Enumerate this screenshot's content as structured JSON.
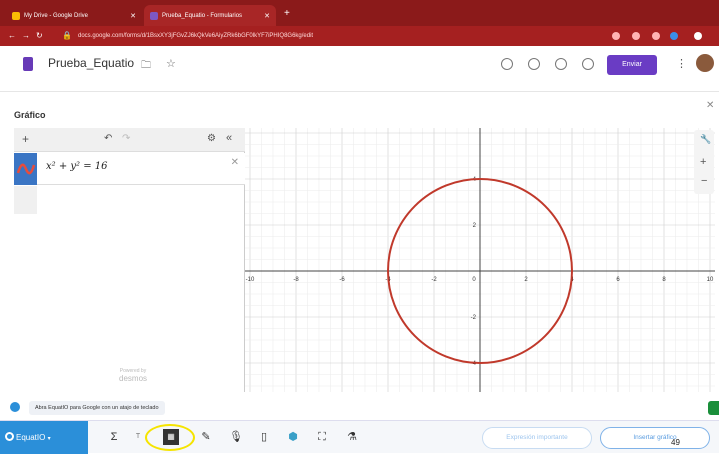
{
  "browser": {
    "tabs": [
      {
        "title": "My Drive - Google Drive",
        "active": false,
        "favicon_color": "#fbbc04"
      },
      {
        "title": "Prueba_Equatio - Formularios",
        "active": true,
        "favicon_color": "#7e57c2"
      }
    ],
    "url": "docs.google.com/forms/d/1BsxXY3jFGvZJ6kQkVe6AiyZRk6bGF0lkYF7iPHIQ8G6kg/edit"
  },
  "doc": {
    "title": "Prueba_Equatio",
    "send_label": "Enviar"
  },
  "panel": {
    "title": "Gráfico",
    "expression": "x² + y² = 16",
    "watermark_small": "Powered by",
    "watermark": "desmos"
  },
  "chart_data": {
    "type": "scatter",
    "title": "",
    "xlabel": "",
    "ylabel": "",
    "xlim": [
      -10,
      10
    ],
    "ylim": [
      -5.5,
      5.5
    ],
    "grid": true,
    "x_ticks": [
      -10,
      -8,
      -6,
      -4,
      -2,
      0,
      2,
      4,
      6,
      8,
      10
    ],
    "y_ticks": [
      -4,
      -2,
      2,
      4
    ],
    "x_tick_labels": [
      "-10",
      "-8",
      "-6",
      "-4",
      "-2",
      "0",
      "2",
      "4",
      "6",
      "8",
      "10"
    ],
    "y_tick_labels": [
      "-4",
      "-2",
      "2",
      "4"
    ],
    "curves": [
      {
        "equation": "x^2 + y^2 = 16",
        "center": [
          0,
          0
        ],
        "radius": 4,
        "color": "#c0392b"
      }
    ]
  },
  "equatio": {
    "hint": "Abra EquatIO para Google con un atajo de teclado",
    "brand": "EquatIO",
    "buttons": {
      "import": "Expresión importante",
      "insert": "Insertar gráfico"
    },
    "tools": [
      "math-icon",
      "text-icon",
      "graph-icon",
      "handwriting-icon",
      "speech-icon",
      "mobile-icon",
      "chemistry-icon",
      "screenshot-icon",
      "lab-icon"
    ]
  },
  "page_number": "49"
}
